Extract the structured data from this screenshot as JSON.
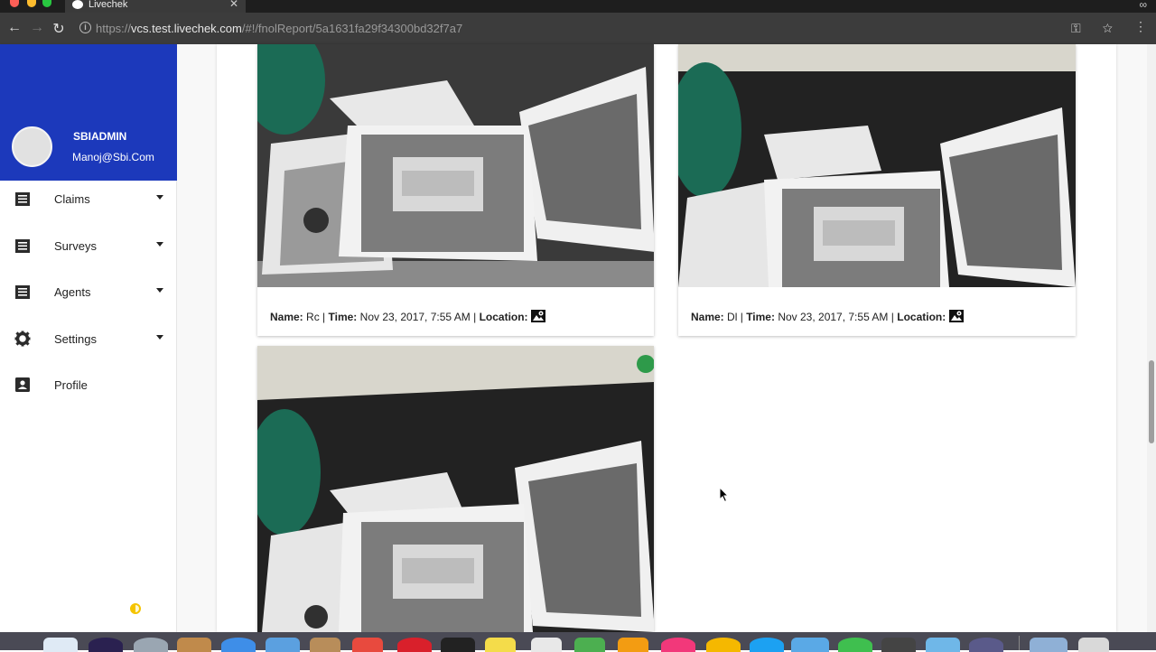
{
  "browser": {
    "tab_title": "Livechek",
    "url_scheme": "https://",
    "url_host": "vcs.test.livechek.com",
    "url_path": "/#!/fnolReport/5a1631fa29f34300bd32f7a7"
  },
  "sidebar": {
    "header_color": "#1c39bb",
    "user_name": "SBIADMIN",
    "user_email": "Manoj@Sbi.Com",
    "items": [
      {
        "label": "Claims",
        "icon": "list-icon",
        "has_caret": true
      },
      {
        "label": "Surveys",
        "icon": "list-icon",
        "has_caret": true
      },
      {
        "label": "Agents",
        "icon": "list-icon",
        "has_caret": true
      },
      {
        "label": "Settings",
        "icon": "gear-icon",
        "has_caret": true
      },
      {
        "label": "Profile",
        "icon": "contact-card-icon",
        "has_caret": false
      }
    ]
  },
  "photos": [
    {
      "name_label": "Name:",
      "name": "Rc",
      "time_label": "Time:",
      "time": "Nov 23, 2017, 7:55 AM",
      "location_label": "Location:",
      "sep": "|"
    },
    {
      "name_label": "Name:",
      "name": "Dl",
      "time_label": "Time:",
      "time": "Nov 23, 2017, 7:55 AM",
      "location_label": "Location:",
      "sep": "|"
    },
    {
      "name_label": "",
      "name": "",
      "time_label": "",
      "time": "",
      "location_label": "",
      "sep": ""
    }
  ]
}
